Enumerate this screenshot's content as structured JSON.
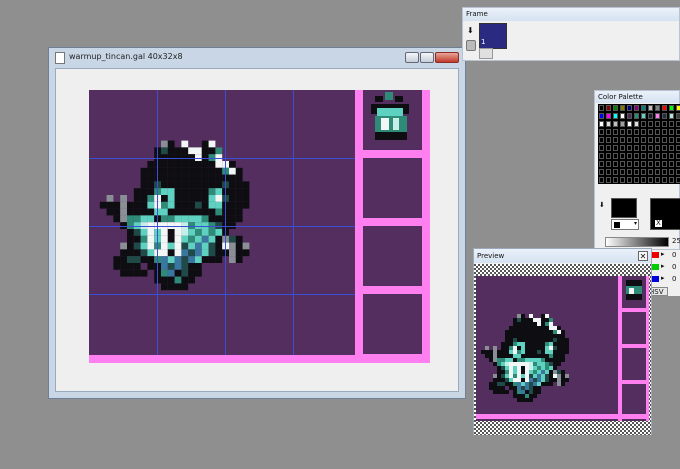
{
  "main_window": {
    "title": "warmup_tincan.gal 40x32x8"
  },
  "frame_window": {
    "title": "Frame",
    "frame_number": "1"
  },
  "color_palette": {
    "title": "Color Palette",
    "swatch_colors": [
      "#000000",
      "#800000",
      "#008000",
      "#808000",
      "#000080",
      "#800080",
      "#008080",
      "#c0c0c0",
      "#808080",
      "#ff0000",
      "#00ff00",
      "#ffff00",
      "#0000ff",
      "#ff00ff",
      "#00ffff",
      "#ffffff",
      "#4a2b5c",
      "#2e8b78",
      "#5ed1c0",
      "#1a1a2e",
      "#ff7ff0",
      "#203040",
      "#aee5dd",
      "#3c3c3c"
    ],
    "alpha_value": "25",
    "red_value": "0",
    "green_value": "0",
    "blue_value": "0",
    "x_label": "X",
    "hsv_label": "HSV"
  },
  "preview_window": {
    "title": "Preview"
  },
  "colors": {
    "background": "#542e5e",
    "frame_border": "#ff7ff0",
    "grid": "#3a4fd6",
    "black": "#0d0d12",
    "dark_teal": "#1f4a48",
    "teal": "#2e8b78",
    "light_teal": "#5ed1c0",
    "pale": "#c6efe9",
    "white": "#f2f7f6",
    "gray": "#8a8f96",
    "blue": "#3a77a0"
  }
}
